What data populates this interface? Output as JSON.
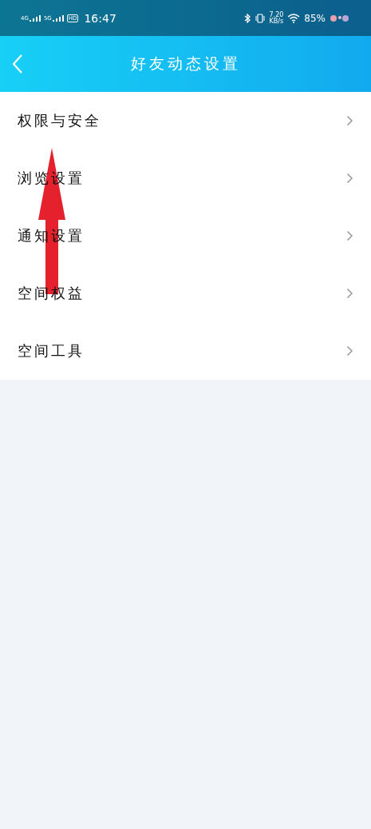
{
  "status_bar": {
    "network_1": "4G",
    "network_2": "5G",
    "hd": "HD",
    "time": "16:47",
    "speed_value": "7.20",
    "speed_unit": "KB/s",
    "battery": "85%"
  },
  "header": {
    "title": "好友动态设置"
  },
  "settings": [
    {
      "label": "权限与安全"
    },
    {
      "label": "浏览设置"
    },
    {
      "label": "通知设置"
    },
    {
      "label": "空间权益"
    },
    {
      "label": "空间工具"
    }
  ]
}
